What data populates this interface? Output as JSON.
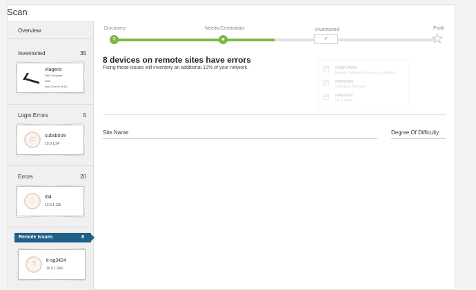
{
  "page": {
    "title": "Scan"
  },
  "sidebar": {
    "overview_label": "Overview",
    "sections": [
      {
        "label": "Inventoried",
        "count": "35",
        "card": {
          "name": "vtagens",
          "lines": [
            "Dell Computer",
            "4GB",
            "Intel Core i5 M 43..."
          ],
          "icon": "laptop-icon"
        }
      },
      {
        "label": "Login Errors",
        "count": "5",
        "card": {
          "name": "subsb009",
          "ip": "10.0.1.34",
          "icon": "user-icon"
        }
      },
      {
        "label": "Errors",
        "count": "20",
        "card": {
          "name": "t04",
          "ip": "10.0.1.115",
          "icon": "flame-icon"
        }
      },
      {
        "label": "Remote Issues",
        "count": "8",
        "selected": true,
        "card": {
          "name": "ti-sg3424",
          "ip": "10.0.1.240",
          "icon": "question-icon"
        }
      }
    ]
  },
  "progress": {
    "steps": [
      "Discovery",
      "Needs Credentials",
      "Inventoried",
      "Profit"
    ],
    "active_step_index": 1,
    "accent_color": "#7ab743"
  },
  "main": {
    "heading": "8 devices on remote sites have errors",
    "subheading": "Fixing these issues will inventory an additional 12% of your network.",
    "popup": [
      {
        "title": "COMPUTERS",
        "desc": "Events, Software, Resources, Utilization"
      },
      {
        "title": "SWITCHES",
        "desc": "Utilization, Backups"
      },
      {
        "title": "PRINTERS",
        "desc": "Ink & Toner"
      }
    ],
    "table": {
      "columns": [
        "Site Name",
        "Degree Of Difficulty"
      ]
    }
  },
  "colors": {
    "selected_tab": "#1f5f88",
    "progress_fill": "#7ab743"
  }
}
